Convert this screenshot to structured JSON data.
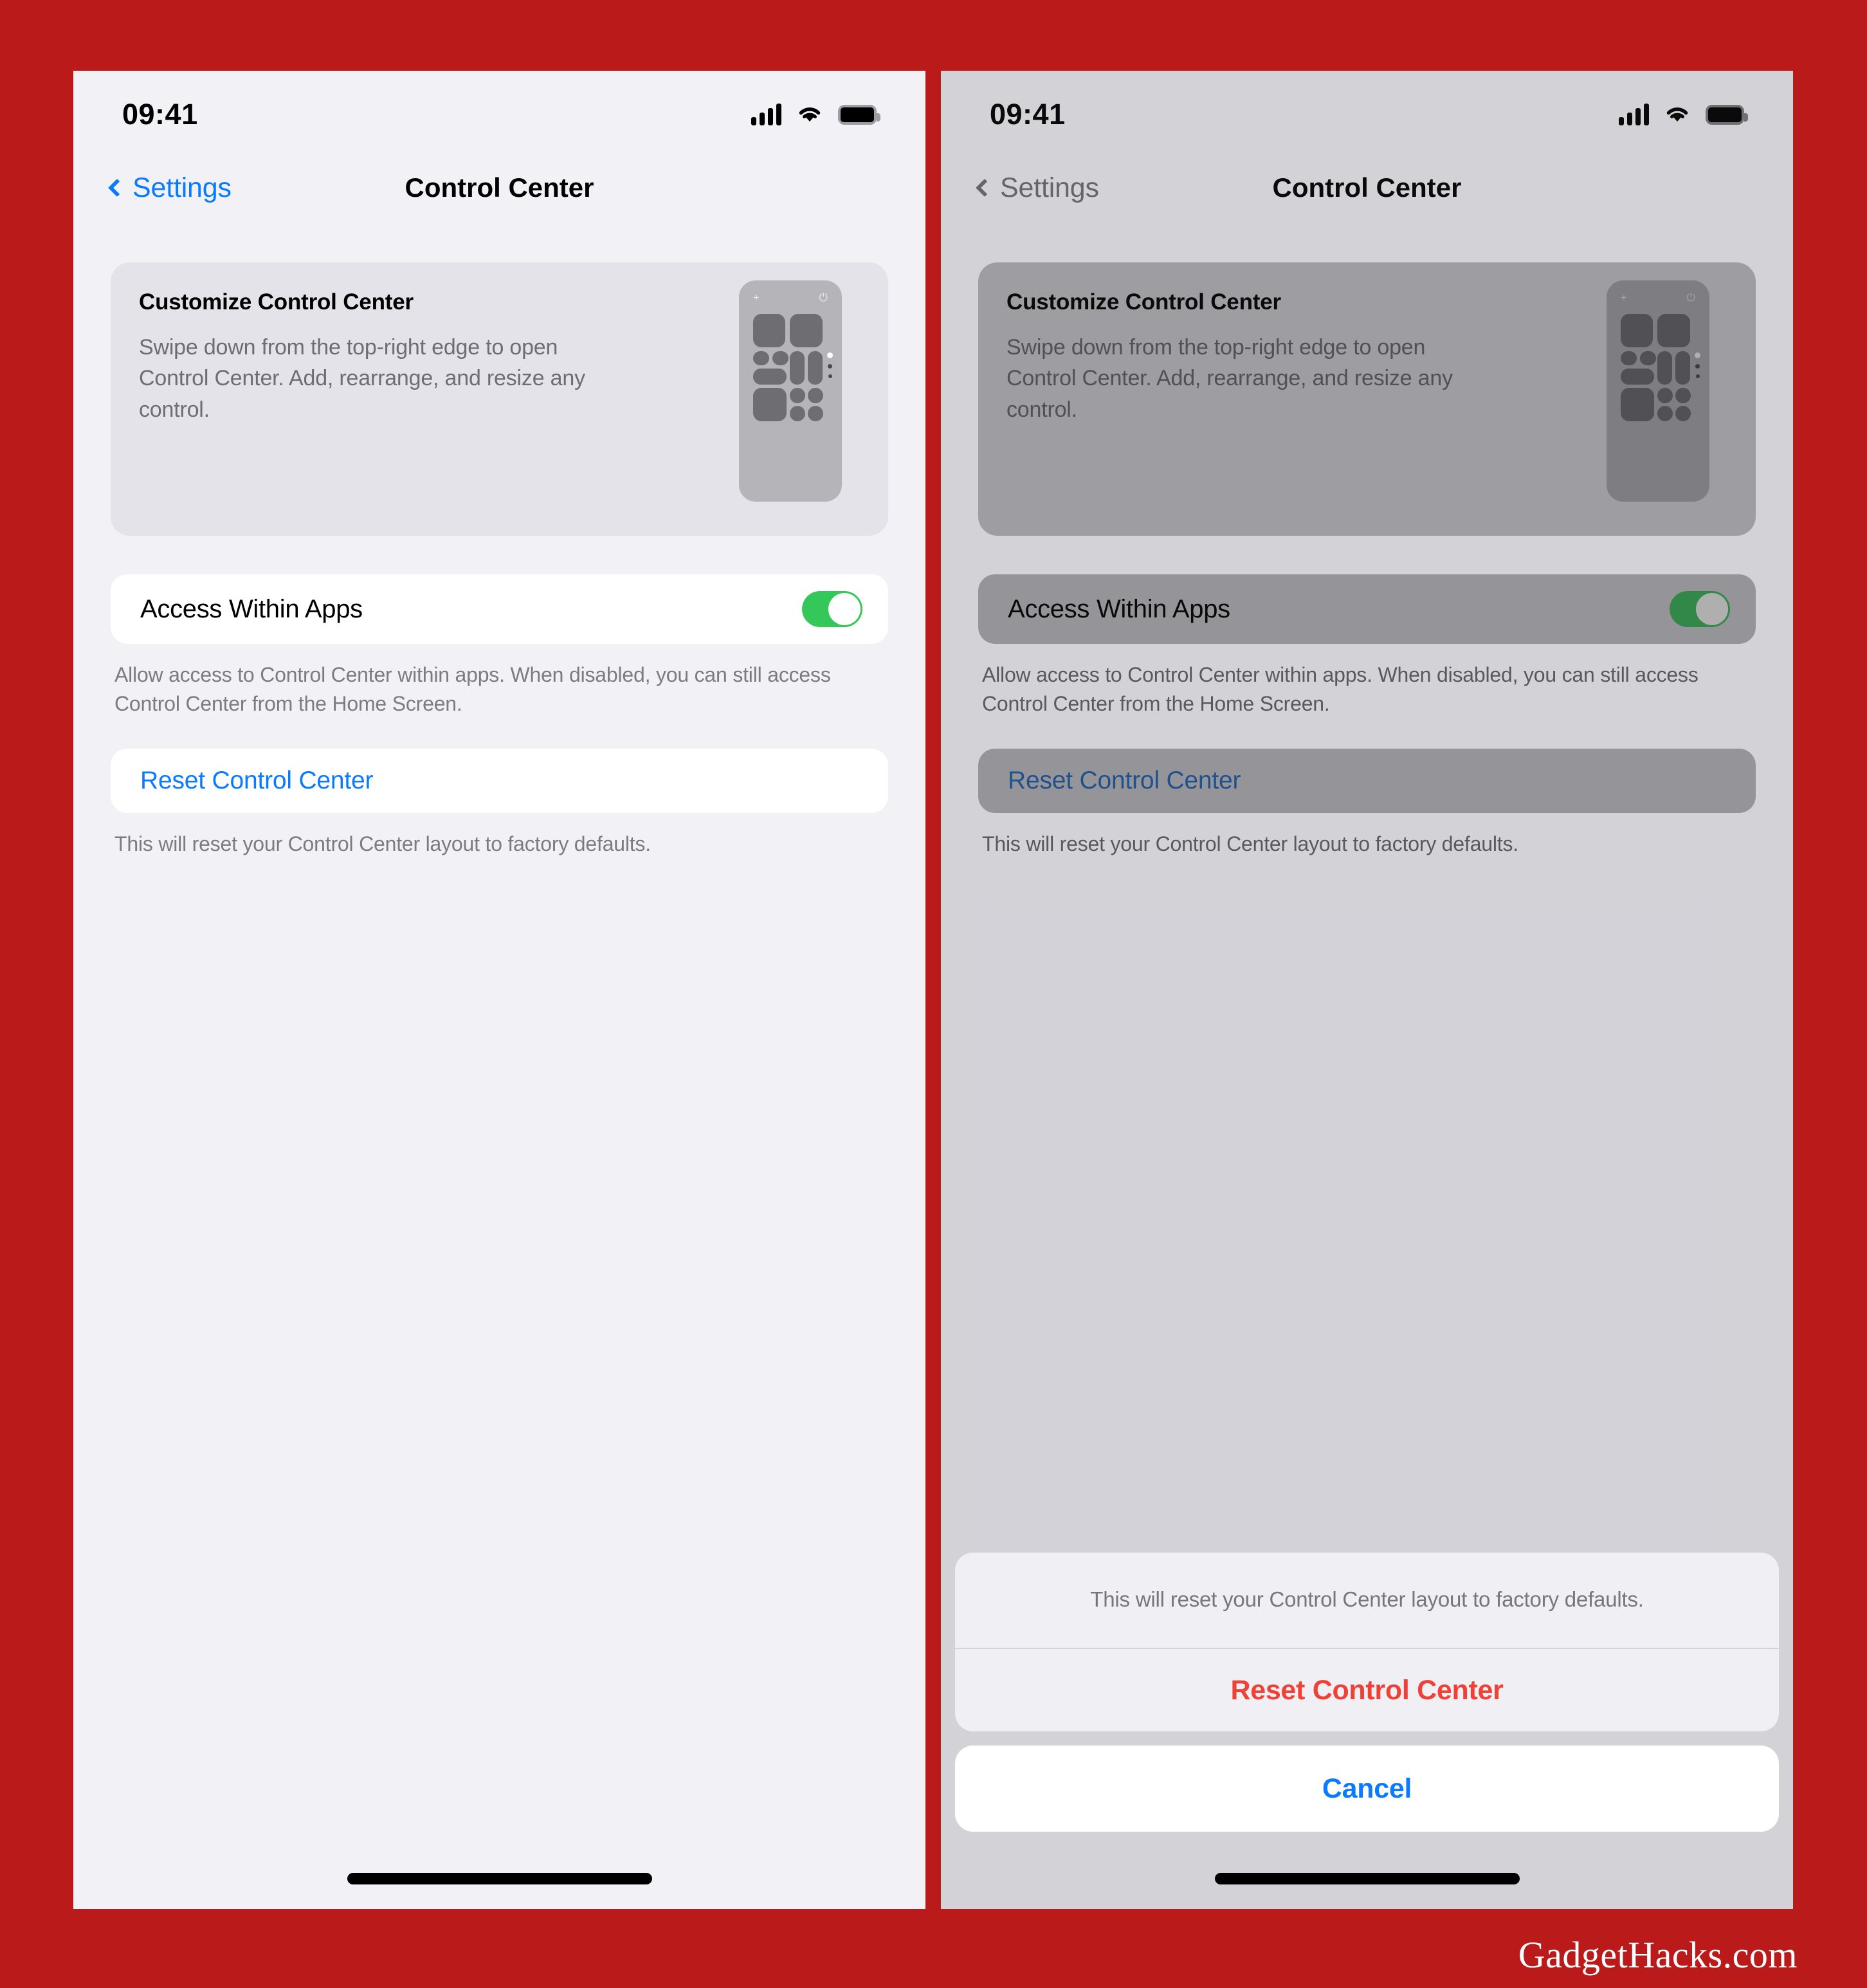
{
  "brand": {
    "accent_blue": "#0a7aff",
    "destructive_red": "#ef4136",
    "toggle_green": "#34c759",
    "frame_red": "#ba1a1a"
  },
  "watermark": "GadgetHacks.com",
  "status_bar": {
    "time": "09:41",
    "signal_icon": "cellular-bars-icon",
    "wifi_icon": "wifi-icon",
    "battery_icon": "battery-full-icon"
  },
  "nav": {
    "back_label": "Settings",
    "title": "Control Center"
  },
  "info_card": {
    "title": "Customize Control Center",
    "body": "Swipe down from the top-right edge to open Control Center. Add, rearrange, and resize any control.",
    "phone_plus_icon": "+",
    "phone_power_icon": "⏻"
  },
  "access_row": {
    "label": "Access Within Apps",
    "toggle_state": "on"
  },
  "access_footnote": "Allow access to Control Center within apps. When disabled, you can still access Control Center from the Home Screen.",
  "reset_row": {
    "label": "Reset Control Center"
  },
  "reset_footnote": "This will reset your Control Center layout to factory defaults.",
  "action_sheet": {
    "message": "This will reset your Control Center layout to factory defaults.",
    "destructive_label": "Reset Control Center",
    "cancel_label": "Cancel"
  }
}
